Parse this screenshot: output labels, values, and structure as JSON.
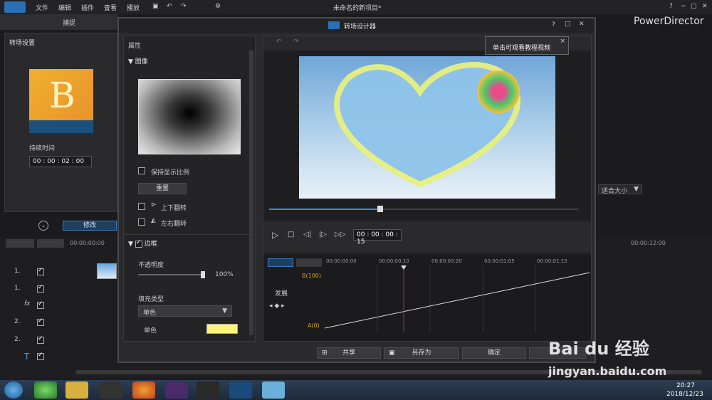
{
  "menu": {
    "items": [
      "文件",
      "编辑",
      "插件",
      "查看",
      "播放"
    ],
    "project_title": "未命名的新项目*",
    "app_name": "PowerDirector",
    "help": "?",
    "minimize": "−",
    "restore": "□",
    "close": "✕"
  },
  "left_tabs": {
    "capture": "捕捉"
  },
  "transition_settings": {
    "title": "转场设置",
    "duration_label": "持续时间",
    "duration_value": "00 : 00 : 02 : 00",
    "thumb_letter": "B"
  },
  "modify_button": "修改",
  "designer": {
    "title": "转场设计器",
    "help": "?",
    "tooltip": "单击可观看教程视频",
    "tooltip_close": "×",
    "properties_title": "属性",
    "image_section": "图像",
    "keep_ratio": "保持显示比例",
    "reset": "重置",
    "flip_v": "上下翻转",
    "flip_h": "左右翻转",
    "border_section": "边框",
    "opacity_label": "不透明度",
    "opacity_value": "100%",
    "opacity_fraction": 1.0,
    "fill_type_label": "填充类型",
    "fill_type_value": "单色",
    "solid_label": "单色",
    "solid_color": "#fff27a",
    "timecode": "00 : 00 : 00 : 15",
    "preview_progress": 0.36,
    "timeline_ticks": [
      "00:00:00:00",
      "00:00:00:10",
      "00:00:00:20",
      "00:00:01:05",
      "00:00:01:15"
    ],
    "kf_top": "B(100)",
    "kf_bottom": "A(0)",
    "track_label": "发展",
    "buttons": {
      "share": "共享",
      "save_as": "另存为",
      "ok": "确定"
    }
  },
  "right_panel": {
    "fit": "适合大小"
  },
  "timeline": {
    "ruler_start": "00:00:00:00",
    "ruler_end": "00:00:12:00",
    "tracks": [
      "1.",
      "1.",
      "fx",
      "2.",
      "2.",
      "T"
    ]
  },
  "taskbar": {
    "time": "20:27",
    "date": "2018/12/23"
  },
  "watermark": {
    "text": "Bai du 经验",
    "url": "jingyan.baidu.com"
  }
}
